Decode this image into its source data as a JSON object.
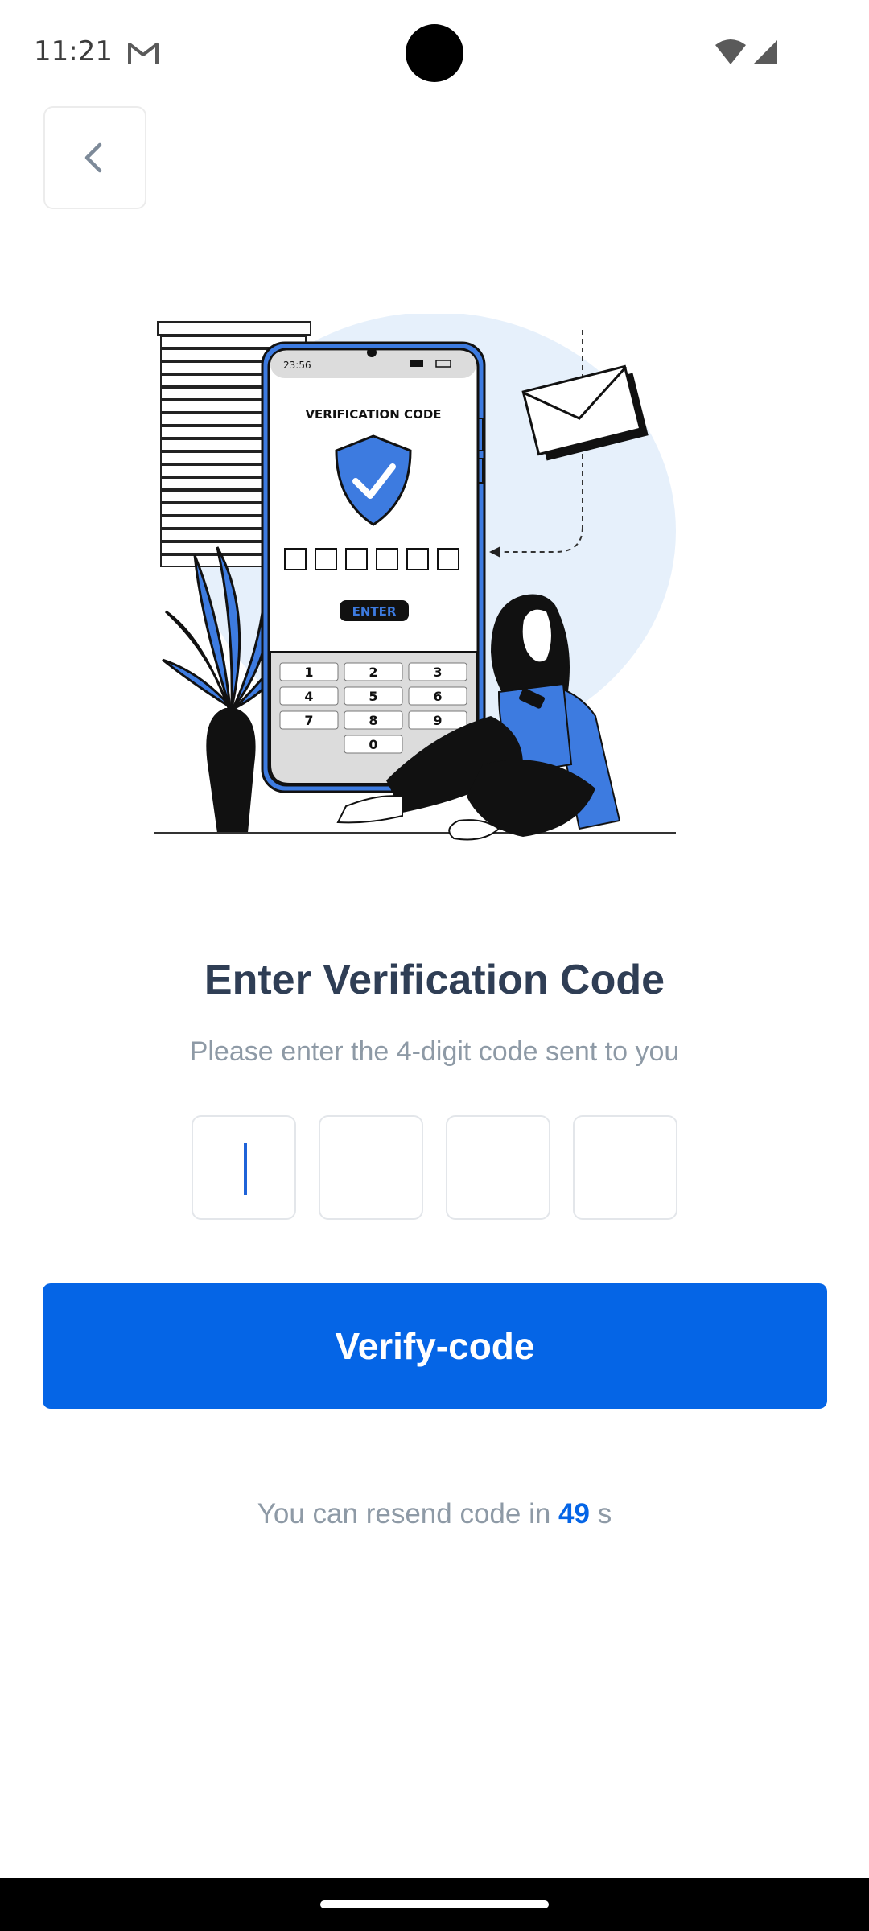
{
  "status_bar": {
    "time": "11:21",
    "icons": [
      "gmail-icon",
      "wifi-icon",
      "signal-icon"
    ]
  },
  "header": {
    "back_icon": "chevron-left-icon"
  },
  "illustration": {
    "phone_time": "23:56",
    "screen_title": "VERIFICATION CODE",
    "enter_label": "ENTER",
    "keypad": [
      "1",
      "2",
      "3",
      "4",
      "5",
      "6",
      "7",
      "8",
      "9",
      "0"
    ]
  },
  "main": {
    "title": "Enter Verification Code",
    "subtitle": "Please enter the 4-digit code sent to you",
    "code_boxes": [
      "",
      "",
      "",
      ""
    ],
    "verify_label": "Verify-code",
    "resend_prefix": "You can resend code in",
    "resend_count": "49",
    "resend_suffix": "s"
  },
  "colors": {
    "primary": "#0565e6",
    "title": "#2f3e55",
    "muted": "#8e9aa6",
    "illustration_blue": "#3d7be0",
    "illustration_bg": "#e6f0fb"
  }
}
